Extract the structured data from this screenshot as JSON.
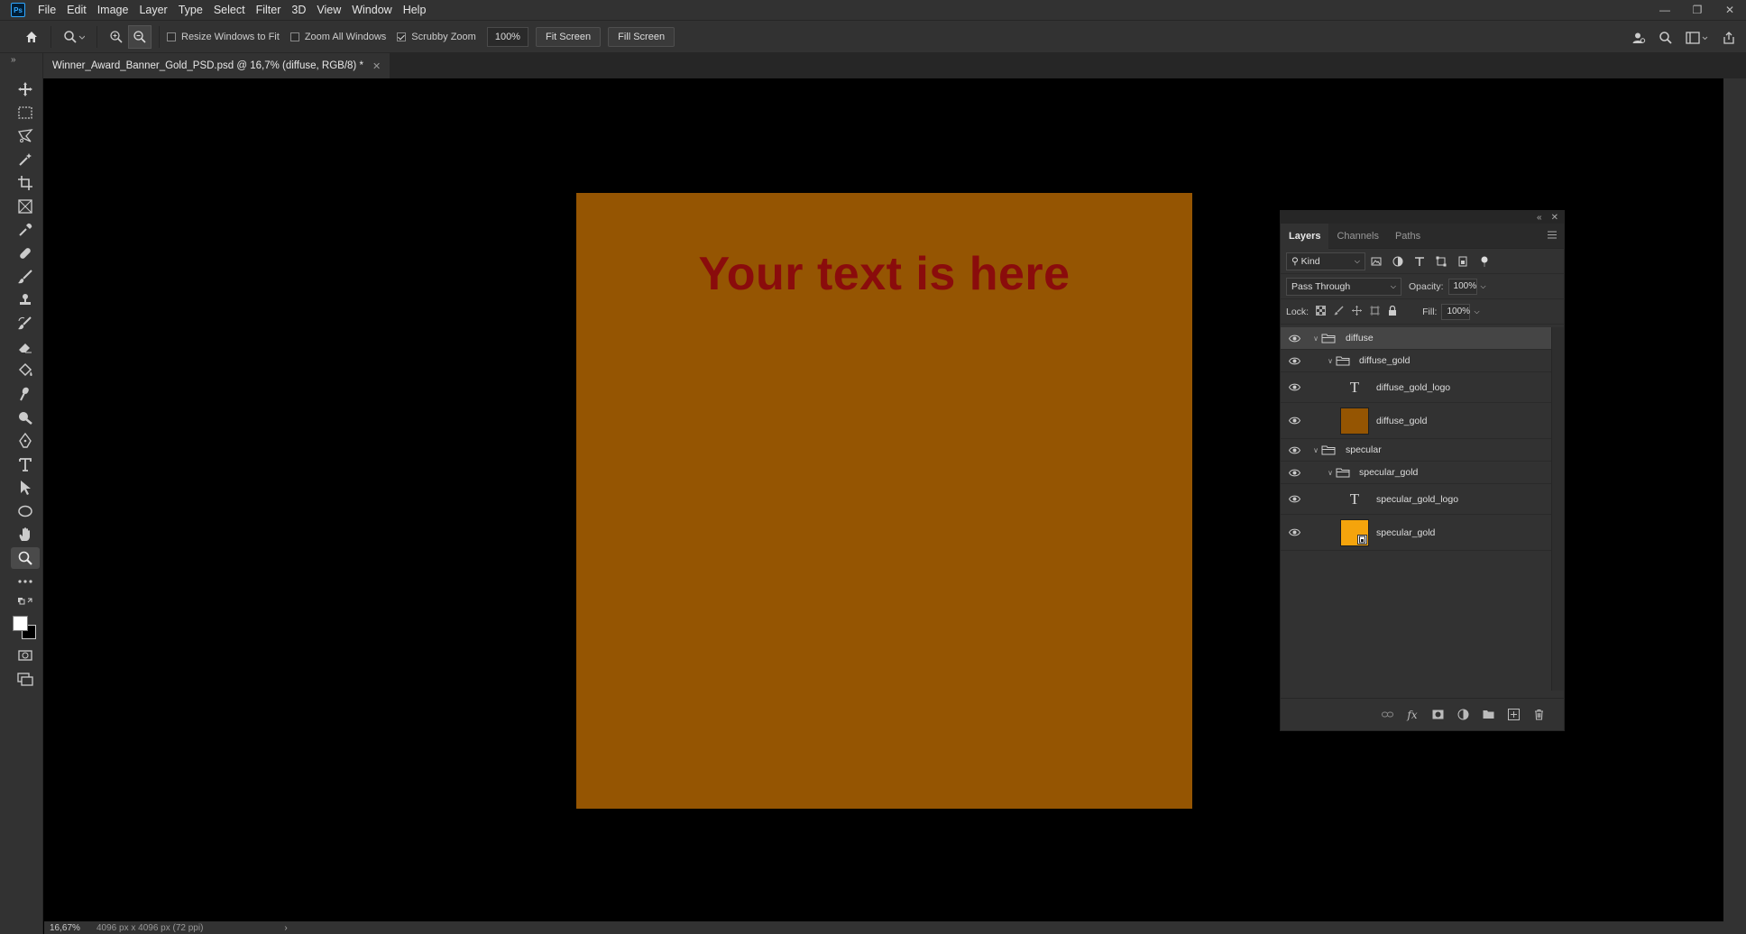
{
  "app": {
    "logo": "Ps"
  },
  "menu": [
    "File",
    "Edit",
    "Image",
    "Layer",
    "Type",
    "Select",
    "Filter",
    "3D",
    "View",
    "Window",
    "Help"
  ],
  "options": {
    "resize_windows": "Resize Windows to Fit",
    "resize_windows_checked": false,
    "zoom_all": "Zoom All Windows",
    "zoom_all_checked": false,
    "scrubby_zoom": "Scrubby Zoom",
    "scrubby_zoom_checked": true,
    "zoom_value": "100%",
    "fit_screen": "Fit Screen",
    "fill_screen": "Fill Screen"
  },
  "document": {
    "tab_title": "Winner_Award_Banner_Gold_PSD.psd @ 16,7% (diffuse, RGB/8) *",
    "canvas_text": "Your text is here",
    "canvas_color": "#955502",
    "text_color": "#8a0c0c"
  },
  "status": {
    "zoom": "16,67%",
    "info": "4096 px x 4096 px (72 ppi)"
  },
  "layers_panel": {
    "tabs": [
      "Layers",
      "Channels",
      "Paths"
    ],
    "filter_kind": "Kind",
    "blend_mode": "Pass Through",
    "opacity_label": "Opacity:",
    "opacity": "100%",
    "lock_label": "Lock:",
    "fill_label": "Fill:",
    "fill": "100%",
    "layers": [
      {
        "name": "diffuse",
        "type": "group",
        "depth": 0,
        "expanded": true,
        "selected": true
      },
      {
        "name": "diffuse_gold",
        "type": "group",
        "depth": 1,
        "expanded": true,
        "selected": false
      },
      {
        "name": "diffuse_gold_logo",
        "type": "text",
        "depth": 2,
        "selected": false
      },
      {
        "name": "diffuse_gold",
        "type": "pixel",
        "depth": 2,
        "thumb_color": "#955502",
        "selected": false
      },
      {
        "name": "specular",
        "type": "group",
        "depth": 0,
        "expanded": true,
        "selected": false
      },
      {
        "name": "specular_gold",
        "type": "group",
        "depth": 1,
        "expanded": true,
        "selected": false
      },
      {
        "name": "specular_gold_logo",
        "type": "text",
        "depth": 2,
        "selected": false
      },
      {
        "name": "specular_gold",
        "type": "smart",
        "depth": 2,
        "thumb_color": "#f5a40c",
        "selected": false
      }
    ]
  }
}
